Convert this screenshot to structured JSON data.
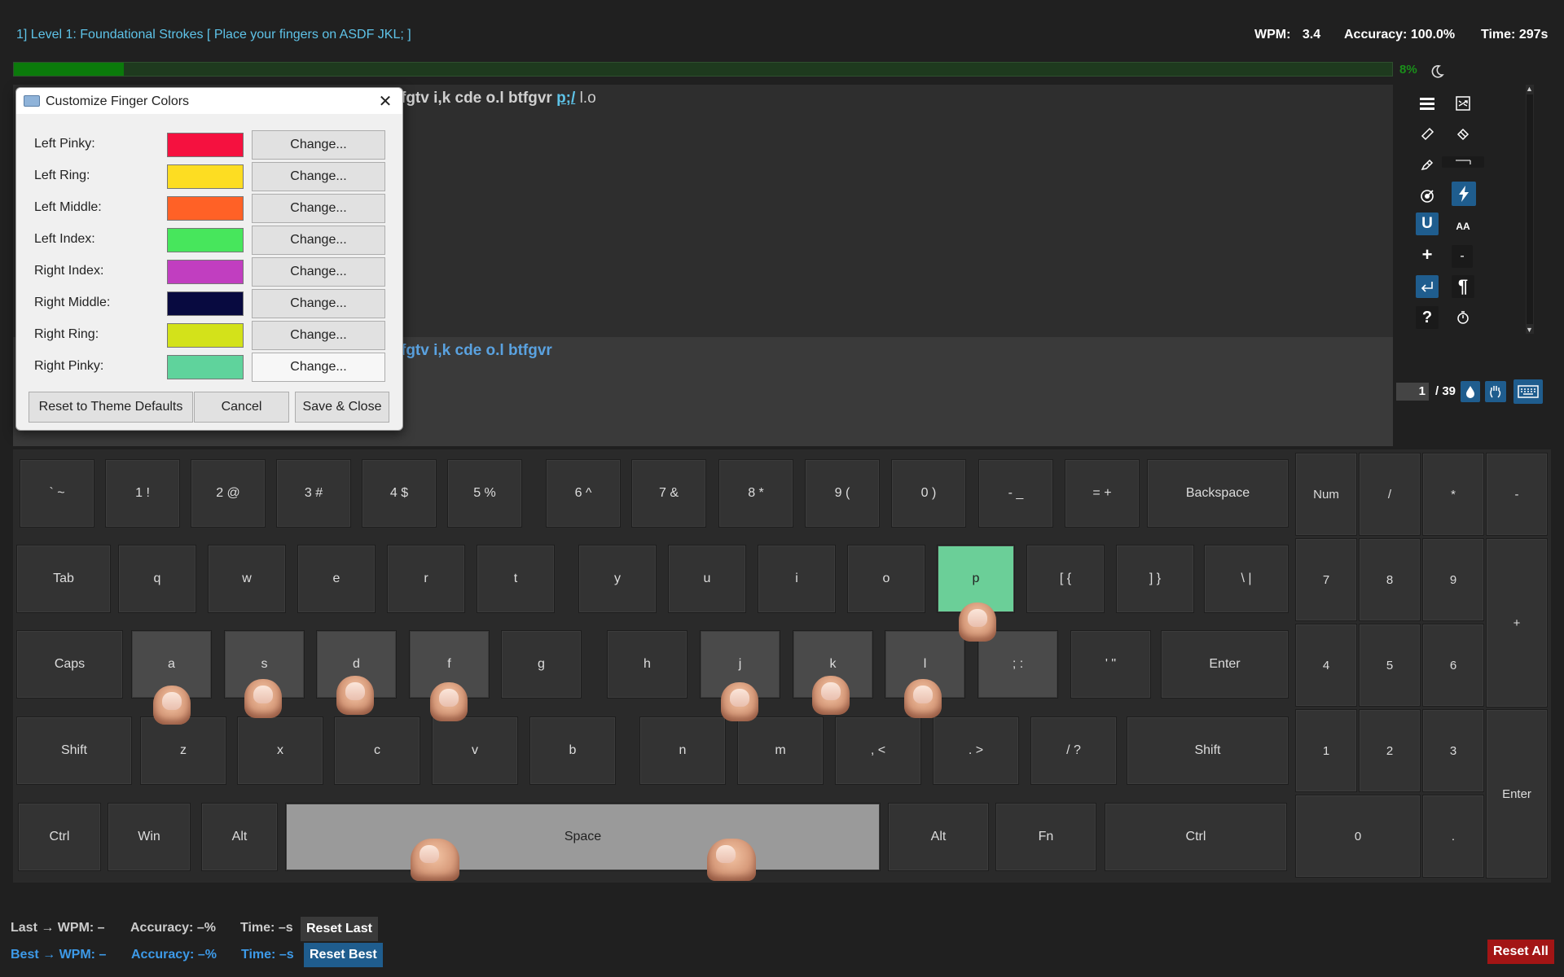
{
  "header": {
    "level_title": "1] Level 1: Foundational Strokes [ Place your fingers on ASDF JKL; ]",
    "wpm_label": "WPM:",
    "wpm_value": "3.4",
    "accuracy": "Accuracy: 100.0%",
    "time": "Time: 297s"
  },
  "progress": {
    "fraction": 0.08,
    "label": "8%"
  },
  "text": {
    "typed": "fgtv i,k cde o.l btfgvr ",
    "current": "p;/",
    "remaining": " l.o",
    "preview": "fgtv i,k cde o.l btfgvr"
  },
  "toolbar": {
    "left_icons": [
      "menu-icon",
      "ruler-icon",
      "highlighter-icon",
      "target-icon",
      "underline-icon",
      "plus-icon",
      "enter-icon",
      "help-icon"
    ],
    "right_icons": [
      "shuffle-icon",
      "eraser-icon",
      "slider-icon",
      "lightning-icon",
      "font-size-icon",
      "minus-icon",
      "pilcrow-icon",
      "timer-icon"
    ],
    "underline_glyph": "U",
    "plus_glyph": "+",
    "minus_glyph": "-",
    "help_glyph": "?",
    "pilcrow_glyph": "¶",
    "font_glyph": "AA"
  },
  "page_nav": {
    "current": "1",
    "total": "/ 39"
  },
  "keyboard": {
    "row1": [
      "` ~",
      "1 !",
      "2 @",
      "3 #",
      "4 $",
      "5 %",
      "6 ^",
      "7 &",
      "8 *",
      "9 (",
      "0 )",
      "- _",
      "= +",
      "Backspace"
    ],
    "row2": [
      "Tab",
      "q",
      "w",
      "e",
      "r",
      "t",
      "y",
      "u",
      "i",
      "o",
      "p",
      "[ {",
      "] }",
      "\\ |"
    ],
    "row3": [
      "Caps",
      "a",
      "s",
      "d",
      "f",
      "g",
      "h",
      "j",
      "k",
      "l",
      "; :",
      "' \"",
      "Enter"
    ],
    "row4": [
      "Shift",
      "z",
      "x",
      "c",
      "v",
      "b",
      "n",
      "m",
      ", <",
      ". >",
      "/ ?",
      "Shift"
    ],
    "row5": [
      "Ctrl",
      "Win",
      "Alt",
      "Space",
      "Alt",
      "Fn",
      "Ctrl"
    ],
    "numpad": [
      "Num",
      "/",
      "*",
      "-",
      "7",
      "8",
      "9",
      "+",
      "4",
      "5",
      "6",
      "1",
      "2",
      "3",
      "Enter",
      "0",
      "."
    ],
    "target_key": "p"
  },
  "dialog": {
    "title": "Customize Finger Colors",
    "rows": [
      {
        "label": "Left Pinky:",
        "color": "#f5113f"
      },
      {
        "label": "Left Ring:",
        "color": "#fddd22"
      },
      {
        "label": "Left Middle:",
        "color": "#ff6126"
      },
      {
        "label": "Left Index:",
        "color": "#47e65c"
      },
      {
        "label": "Right Index:",
        "color": "#c13ec0"
      },
      {
        "label": "Right Middle:",
        "color": "#080a40"
      },
      {
        "label": "Right Ring:",
        "color": "#d3e21a"
      },
      {
        "label": "Right Pinky:",
        "color": "#5fd39c"
      }
    ],
    "change_label": "Change...",
    "reset_label": "Reset to Theme Defaults",
    "cancel_label": "Cancel",
    "save_label": "Save & Close"
  },
  "footer": {
    "last_wpm": "Last → WPM: –",
    "last_acc": "Accuracy: –%",
    "last_time": "Time: –s",
    "reset_last": "Reset Last",
    "best_wpm": "Best → WPM: –",
    "best_acc": "Accuracy: –%",
    "best_time": "Time: –s",
    "reset_best": "Reset Best",
    "reset_all": "Reset All"
  },
  "colors": {
    "accent": "#1f5d8e",
    "progress": "#0b7a0b",
    "reset_all": "#a31515",
    "target_key": "#6bcf98"
  }
}
